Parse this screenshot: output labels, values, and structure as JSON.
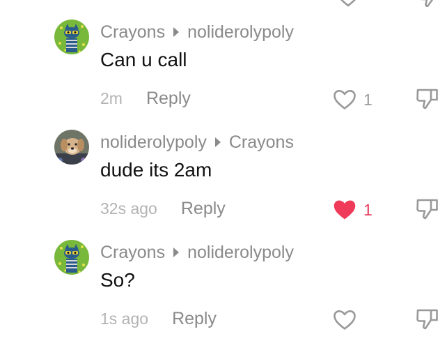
{
  "colors": {
    "muted_text": "#8a8a8a",
    "light_text": "#b3b3b3",
    "body_text": "#111111",
    "liked": "#e63d5c",
    "icon_gray": "#999999"
  },
  "comments": [
    {
      "author": "Crayons",
      "reply_to": "noliderolypoly",
      "text": "Can u call",
      "time": "2m",
      "reply_label": "Reply",
      "likes": "1",
      "liked": false,
      "avatar": "cat-avatar"
    },
    {
      "author": "noliderolypoly",
      "reply_to": "Crayons",
      "text": "dude its 2am",
      "time": "32s ago",
      "reply_label": "Reply",
      "likes": "1",
      "liked": true,
      "avatar": "dog-avatar"
    },
    {
      "author": "Crayons",
      "reply_to": "noliderolypoly",
      "text": "So?",
      "time": "1s ago",
      "reply_label": "Reply",
      "likes": "",
      "liked": false,
      "avatar": "cat-avatar"
    }
  ]
}
